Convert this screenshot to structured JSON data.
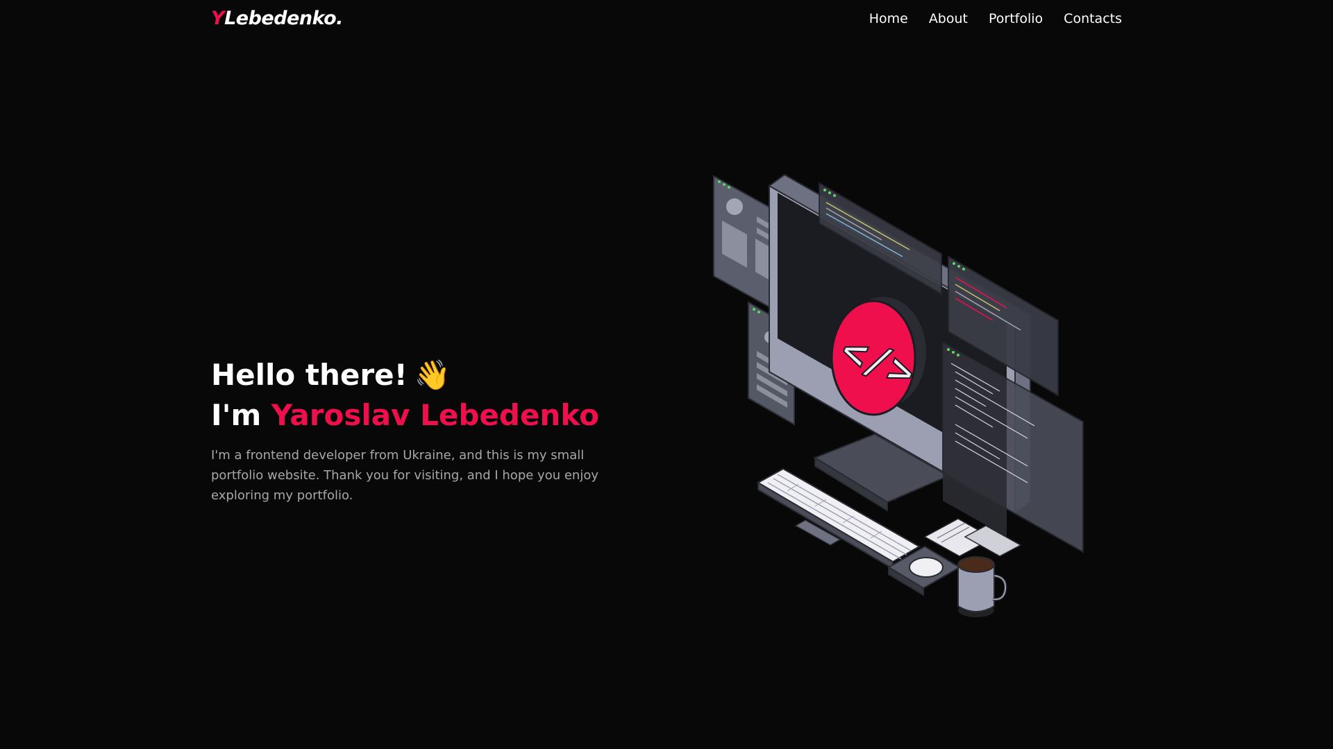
{
  "logo": {
    "initial": "Y",
    "rest": "Lebedenko."
  },
  "nav": {
    "items": [
      {
        "label": "Home"
      },
      {
        "label": "About"
      },
      {
        "label": "Portfolio"
      },
      {
        "label": "Contacts"
      }
    ]
  },
  "hero": {
    "greeting": "Hello there!",
    "wave_emoji": "👋",
    "intro_prefix": "I'm",
    "name": "Yaroslav Lebedenko",
    "description": "I'm a frontend developer from Ukraine, and this is my small portfolio website. Thank you for visiting, and I hope you enjoy exploring my portfolio."
  },
  "illustration": {
    "code_symbol": "</>"
  },
  "colors": {
    "accent": "#f00f4d",
    "background": "#080808",
    "text": "#ffffff",
    "muted_text": "#a8a8a8"
  },
  "icons": [
    "wave-hand-icon",
    "code-brackets-icon"
  ]
}
